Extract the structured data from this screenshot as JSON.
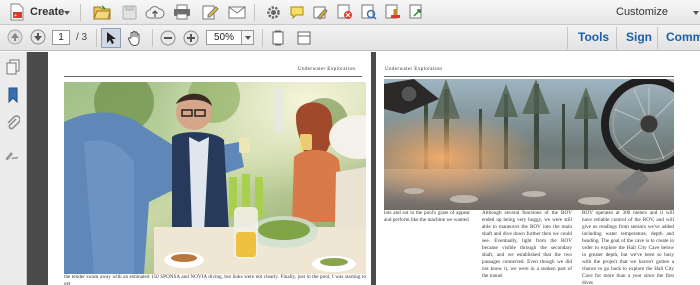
{
  "toolbar_top": {
    "create_label": "Create",
    "customize_label": "Customize"
  },
  "toolbar_nav": {
    "current_page": "1",
    "page_total": "/ 3",
    "zoom_value": "50%",
    "tools_label": "Tools",
    "sign_label": "Sign",
    "comment_label": "Comm"
  },
  "colors": {
    "accent_link": "#1d5fa8",
    "doc_background": "#4b4b4b"
  },
  "document": {
    "left_page": {
      "running_head": "Underwater Exploration",
      "body_text": "the tender swam away with an estimated 150    SPONSA and NOVIA diving, but links were not    clearly. Finally, just in the pool, I was starting to get"
    },
    "right_page": {
      "running_head": "Underwater Exploration",
      "col1": "lots and sat in the pool's grate of appear and perform like the machine we wanted",
      "col2": "Although several functions of the ROV ended up being very buggy, we were still able to maneuver the ROV into the main shaft and dive down further then we could see. Eventually, light from the ROV became visible through the secondary shaft, and we established that the two passages connected. Even though we did not know it, we were in a sunken part of the tunnel",
      "col3": "ROV operates at 300 meters and it will have reliable control of the ROV, and will give us readings from sensors we've added including water temperature, depth and heading. The goal of the cave is to create in order to explore the Hall City Cave below in greater depth, but we've been so busy with the project that we haven't gotten a chance to go back to explore the Hall City Cave for more than a year since the first dives"
    }
  }
}
